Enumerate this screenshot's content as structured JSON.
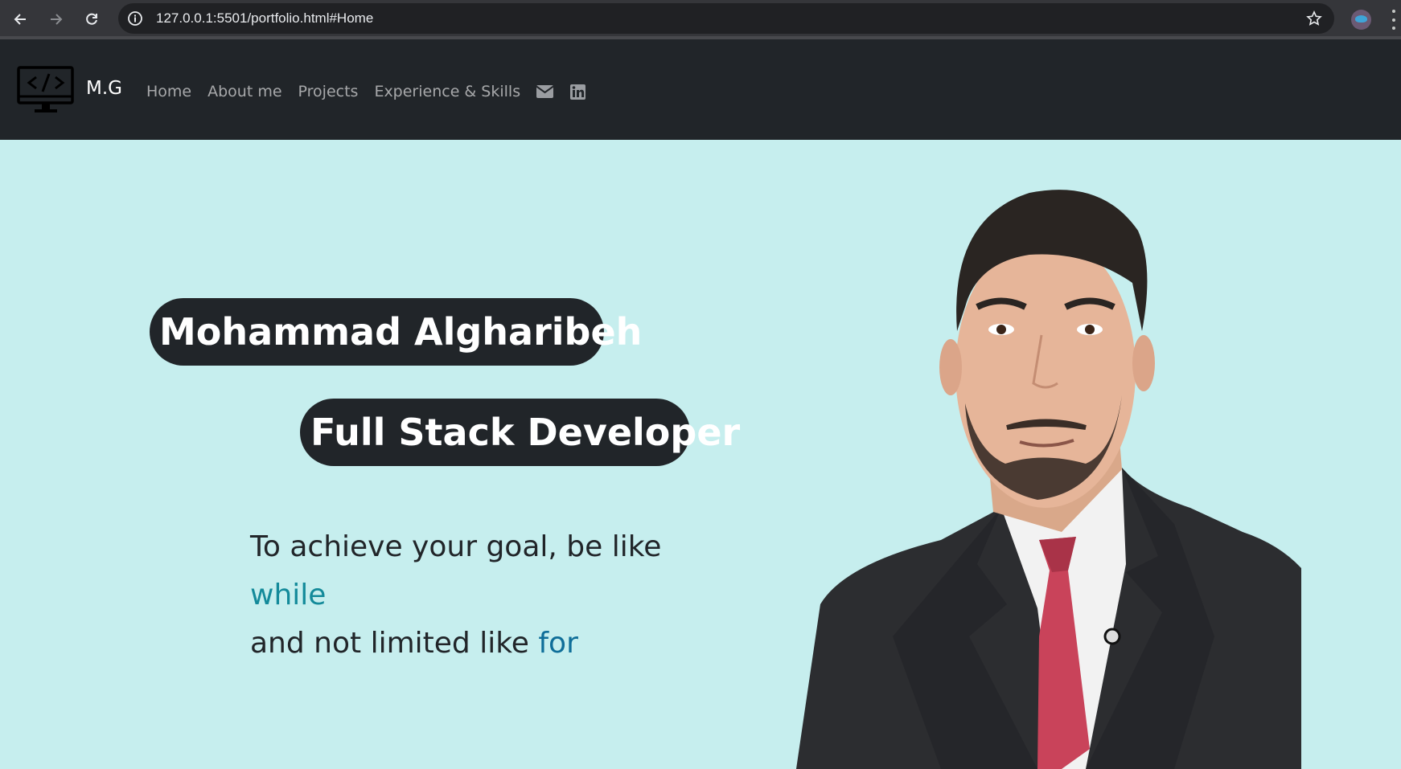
{
  "browser": {
    "url": "127.0.0.1:5501/portfolio.html#Home",
    "icons": [
      "back-arrow-icon",
      "forward-arrow-icon",
      "reload-icon",
      "site-info-icon",
      "bookmark-star-icon",
      "profile-avatar",
      "menu-dots-icon"
    ]
  },
  "navbar": {
    "brand": "M.G",
    "logo_icon": "monitor-code-icon",
    "links": [
      "Home",
      "About me",
      "Projects",
      "Experience & Skills"
    ],
    "icons": [
      "envelope-icon",
      "linkedin-icon"
    ]
  },
  "hero": {
    "name": "Mohammad Algharibeh",
    "role": "Full Stack Developer",
    "quote_line1": "To achieve your goal, be like",
    "quote_keyword1": "while",
    "quote_line3_prefix": "and not limited like",
    "quote_keyword2": "for"
  },
  "colors": {
    "navbar_bg": "#212529",
    "hero_bg": "#c6eeee",
    "pill_bg": "#212529",
    "keyword_while": "#138a9a",
    "keyword_for": "#0f6e99"
  }
}
